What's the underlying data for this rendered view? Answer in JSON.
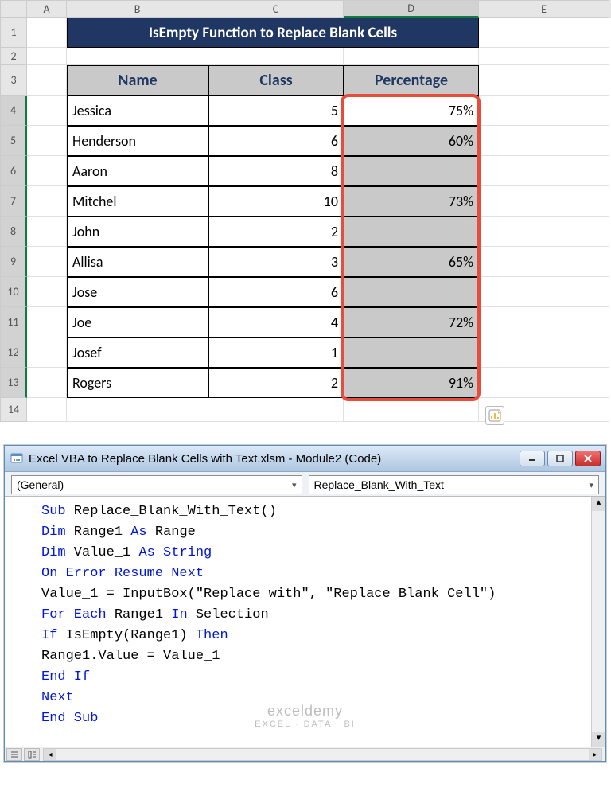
{
  "columns": [
    "A",
    "B",
    "C",
    "D",
    "E"
  ],
  "title": "IsEmpty Function to Replace Blank Cells",
  "header": {
    "name": "Name",
    "class": "Class",
    "pct": "Percentage"
  },
  "rows": [
    {
      "name": "Jessica",
      "class": "5",
      "pct": "75%"
    },
    {
      "name": "Henderson",
      "class": "6",
      "pct": "60%"
    },
    {
      "name": "Aaron",
      "class": "8",
      "pct": ""
    },
    {
      "name": "Mitchel",
      "class": "10",
      "pct": "73%"
    },
    {
      "name": "John",
      "class": "2",
      "pct": ""
    },
    {
      "name": "Allisa",
      "class": "3",
      "pct": "65%"
    },
    {
      "name": "Jose",
      "class": "6",
      "pct": ""
    },
    {
      "name": "Joe",
      "class": "4",
      "pct": "72%"
    },
    {
      "name": "Josef",
      "class": "1",
      "pct": ""
    },
    {
      "name": "Rogers",
      "class": "2",
      "pct": "91%"
    }
  ],
  "row_numbers": [
    "1",
    "2",
    "3",
    "4",
    "5",
    "6",
    "7",
    "8",
    "9",
    "10",
    "11",
    "12",
    "13",
    "14"
  ],
  "vbe": {
    "title": "Excel VBA to Replace Blank Cells with Text.xlsm - Module2 (Code)",
    "drop_left": "(General)",
    "drop_right": "Replace_Blank_With_Text",
    "code": {
      "l1a": "Sub",
      "l1b": " Replace_Blank_With_Text()",
      "l2a": "Dim",
      "l2b": " Range1 ",
      "l2c": "As",
      "l2d": " Range",
      "l3a": "Dim",
      "l3b": " Value_1 ",
      "l3c": "As String",
      "l4": "On Error Resume Next",
      "l5a": "Value_1 = InputBox(",
      "l5b": "\"Replace with\"",
      "l5c": ", ",
      "l5d": "\"Replace Blank Cell\"",
      "l5e": ")",
      "l6a": "For Each",
      "l6b": " Range1 ",
      "l6c": "In",
      "l6d": " Selection",
      "l7a": "If",
      "l7b": " IsEmpty(Range1) ",
      "l7c": "Then",
      "l8": "Range1.Value = Value_1",
      "l9": "End If",
      "l10": "Next",
      "l11": "End Sub"
    }
  },
  "watermark": {
    "brand": "exceldemy",
    "tag": "EXCEL · DATA · BI"
  }
}
